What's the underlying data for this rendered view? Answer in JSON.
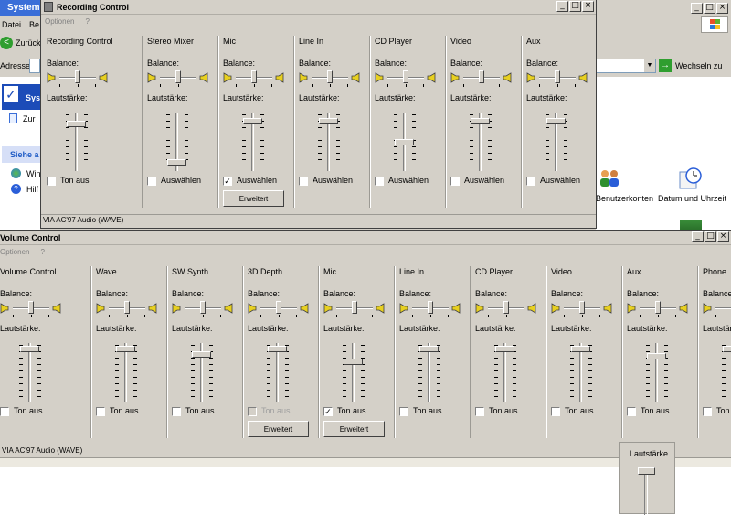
{
  "background": {
    "system_title": "System",
    "menu_datei": "Datei",
    "menu_be": "Be",
    "back_label": "Zurück",
    "adresse_label": "Adresse",
    "go_label": "Wechseln zu",
    "sys_label": "Sys",
    "zur_label": "Zur",
    "siehe_label": "Siehe a",
    "win_label": "Win",
    "hilf_label": "Hilf",
    "benutzerkonten_label": "Benutzerkonten",
    "datum_label": "Datum und Uhrzeit"
  },
  "recording": {
    "title": "Recording Control",
    "menu": [
      "Optionen",
      "?"
    ],
    "status": "VIA AC'97 Audio (WAVE)",
    "balance_label": "Balance:",
    "volume_label": "Lautstärke:",
    "channels": [
      {
        "name": "Recording Control",
        "check_label": "Ton aus",
        "checked": false,
        "volume": 0.85
      },
      {
        "name": "Stereo Mixer",
        "check_label": "Auswählen",
        "checked": false,
        "volume": 0.1
      },
      {
        "name": "Mic",
        "check_label": "Auswählen",
        "checked": true,
        "volume": 0.9,
        "button": "Erweitert"
      },
      {
        "name": "Line In",
        "check_label": "Auswählen",
        "checked": false,
        "volume": 0.9
      },
      {
        "name": "CD Player",
        "check_label": "Auswählen",
        "checked": false,
        "volume": 0.5
      },
      {
        "name": "Video",
        "check_label": "Auswählen",
        "checked": false,
        "volume": 0.9
      },
      {
        "name": "Aux",
        "check_label": "Auswählen",
        "checked": false,
        "volume": 0.9
      }
    ]
  },
  "volume": {
    "title": "Volume Control",
    "menu": [
      "Optionen",
      "?"
    ],
    "status": "VIA AC'97 Audio (WAVE)",
    "balance_label": "Balance:",
    "volume_label": "Lautstärke:",
    "channels": [
      {
        "name": "Volume Control",
        "check_label": "Ton aus",
        "checked": false,
        "volume": 0.95
      },
      {
        "name": "Wave",
        "check_label": "Ton aus",
        "checked": false,
        "volume": 0.95
      },
      {
        "name": "SW Synth",
        "check_label": "Ton aus",
        "checked": false,
        "volume": 0.85
      },
      {
        "name": "3D Depth",
        "check_label": "Ton aus",
        "checked": false,
        "disabled": true,
        "volume": 0.95,
        "button": "Erweitert"
      },
      {
        "name": "Mic",
        "check_label": "Ton aus",
        "checked": true,
        "volume": 0.7,
        "button": "Erweitert"
      },
      {
        "name": "Line In",
        "check_label": "Ton aus",
        "checked": false,
        "volume": 0.95
      },
      {
        "name": "CD Player",
        "check_label": "Ton aus",
        "checked": false,
        "volume": 0.95
      },
      {
        "name": "Video",
        "check_label": "Ton aus",
        "checked": false,
        "volume": 0.95
      },
      {
        "name": "Aux",
        "check_label": "Ton aus",
        "checked": false,
        "volume": 0.8
      },
      {
        "name": "Phone",
        "check_label": "Ton aus",
        "checked": false,
        "volume": 0.95
      }
    ]
  },
  "floating": {
    "label": "Lautstärke"
  }
}
